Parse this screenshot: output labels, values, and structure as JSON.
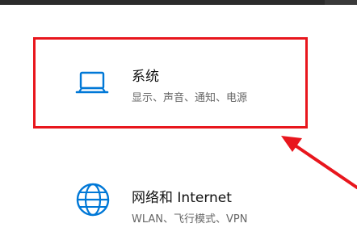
{
  "settings": {
    "system_tile": {
      "title": "系统",
      "description": "显示、声音、通知、电源",
      "icon": "laptop-icon"
    },
    "network_tile": {
      "title": "网络和 Internet",
      "description": "WLAN、飞行模式、VPN",
      "icon": "globe-icon"
    }
  },
  "colors": {
    "accent": "#0078d7",
    "annotation": "#e8161d"
  }
}
